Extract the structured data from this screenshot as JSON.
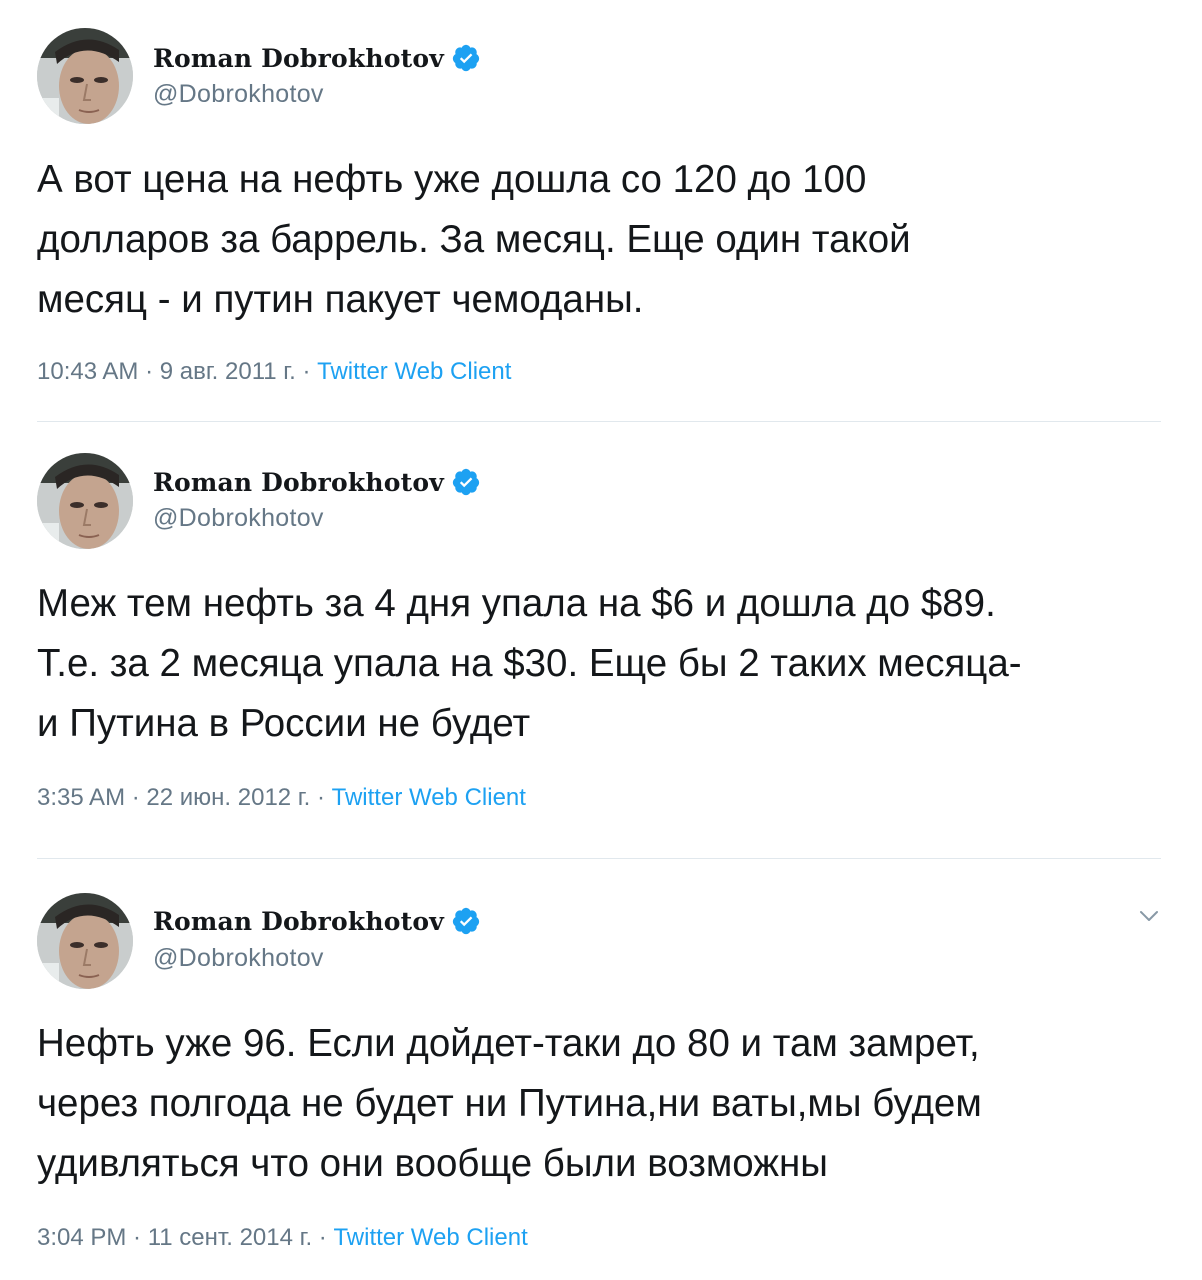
{
  "colors": {
    "text_primary": "#14171a",
    "text_secondary": "#657786",
    "link": "#1da1f2",
    "verified_badge": "#1da1f2",
    "divider": "#e1e8ed"
  },
  "icons": {
    "verified": "verified-badge-icon",
    "caret": "chevron-down-icon"
  },
  "tweets": [
    {
      "author": {
        "name": "Roman Dobrokhotov",
        "handle": "@Dobrokhotov",
        "verified": true
      },
      "text": "А вот цена на нефть уже дошла со 120 до 100\nдолларов за баррель. За месяц. Еще один такой\nмесяц - и путин пакует чемоданы.",
      "time": "10:43 AM",
      "date": "9 авг. 2011 г.",
      "separator": " · ",
      "client": "Twitter Web Client"
    },
    {
      "author": {
        "name": "Roman Dobrokhotov",
        "handle": "@Dobrokhotov",
        "verified": true
      },
      "text": "Меж тем нефть за 4 дня упала на $6 и дошла до $89.\nТ.е. за 2 месяца упала на $30. Еще бы 2 таких месяца-\nи Путина в России не будет",
      "time": "3:35 AM",
      "date": "22 июн. 2012 г.",
      "separator": " · ",
      "client": "Twitter Web Client"
    },
    {
      "author": {
        "name": "Roman Dobrokhotov",
        "handle": "@Dobrokhotov",
        "verified": true
      },
      "text": "Нефть уже 96. Если дойдет-таки до 80 и там замрет,\nчерез полгода не будет ни Путина,ни ваты,мы будем\nудивляться что они вообще были возможны",
      "time": "3:04 PM",
      "date": "11 сент. 2014 г.",
      "separator": " · ",
      "client": "Twitter Web Client"
    }
  ]
}
